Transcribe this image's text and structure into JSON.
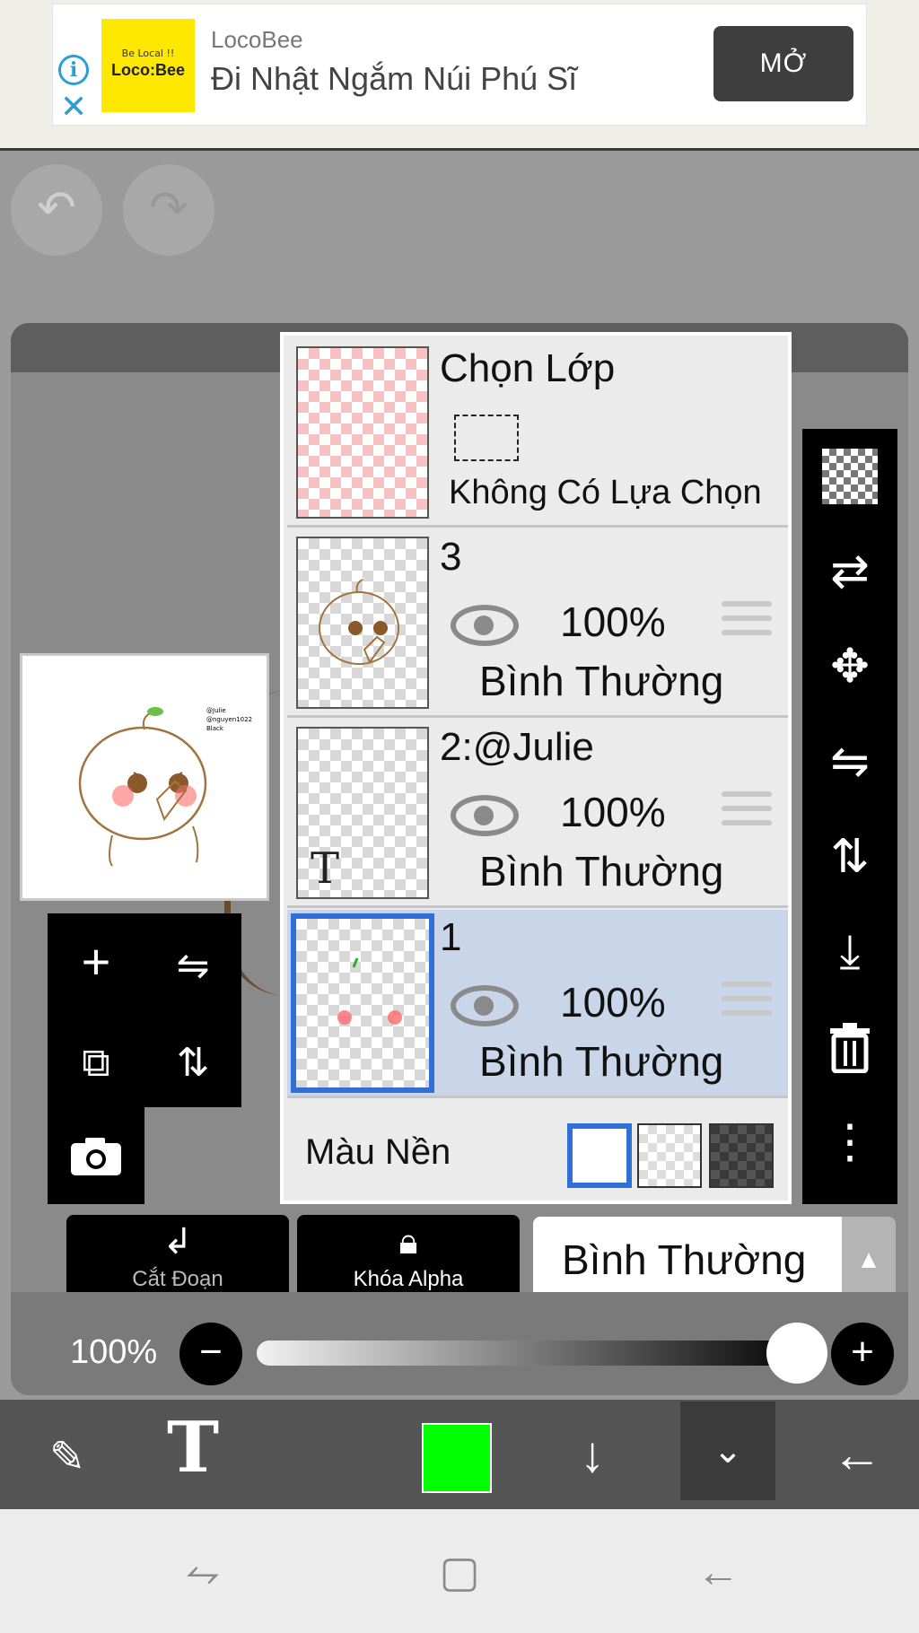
{
  "ad": {
    "logo_small": "Be Local !!",
    "logo_big": "Loco:Bee",
    "brand": "LocoBee",
    "title": "Đi Nhật Ngắm Núi Phú Sĩ",
    "button": "MỞ"
  },
  "thumbnail": {
    "tiny_text": "@Julie\n@nguyen1022\nBlack"
  },
  "layers": {
    "selection": {
      "title": "Chọn Lớp",
      "status": "Không Có Lựa Chọn"
    },
    "items": [
      {
        "name": "3",
        "opacity": "100%",
        "blend": "Bình Thường"
      },
      {
        "name": "2:@Julie",
        "opacity": "100%",
        "blend": "Bình Thường",
        "thumb_glyph": "T"
      },
      {
        "name": "1",
        "opacity": "100%",
        "blend": "Bình Thường"
      }
    ],
    "background_label": "Màu Nền"
  },
  "controls": {
    "clipping": "Cắt Đoạn",
    "alpha_lock": "Khóa Alpha",
    "blend_mode": "Bình Thường",
    "opacity": "100%"
  },
  "colors": {
    "current_color": "#00ff00",
    "selection_accent": "#2f6fd6"
  }
}
